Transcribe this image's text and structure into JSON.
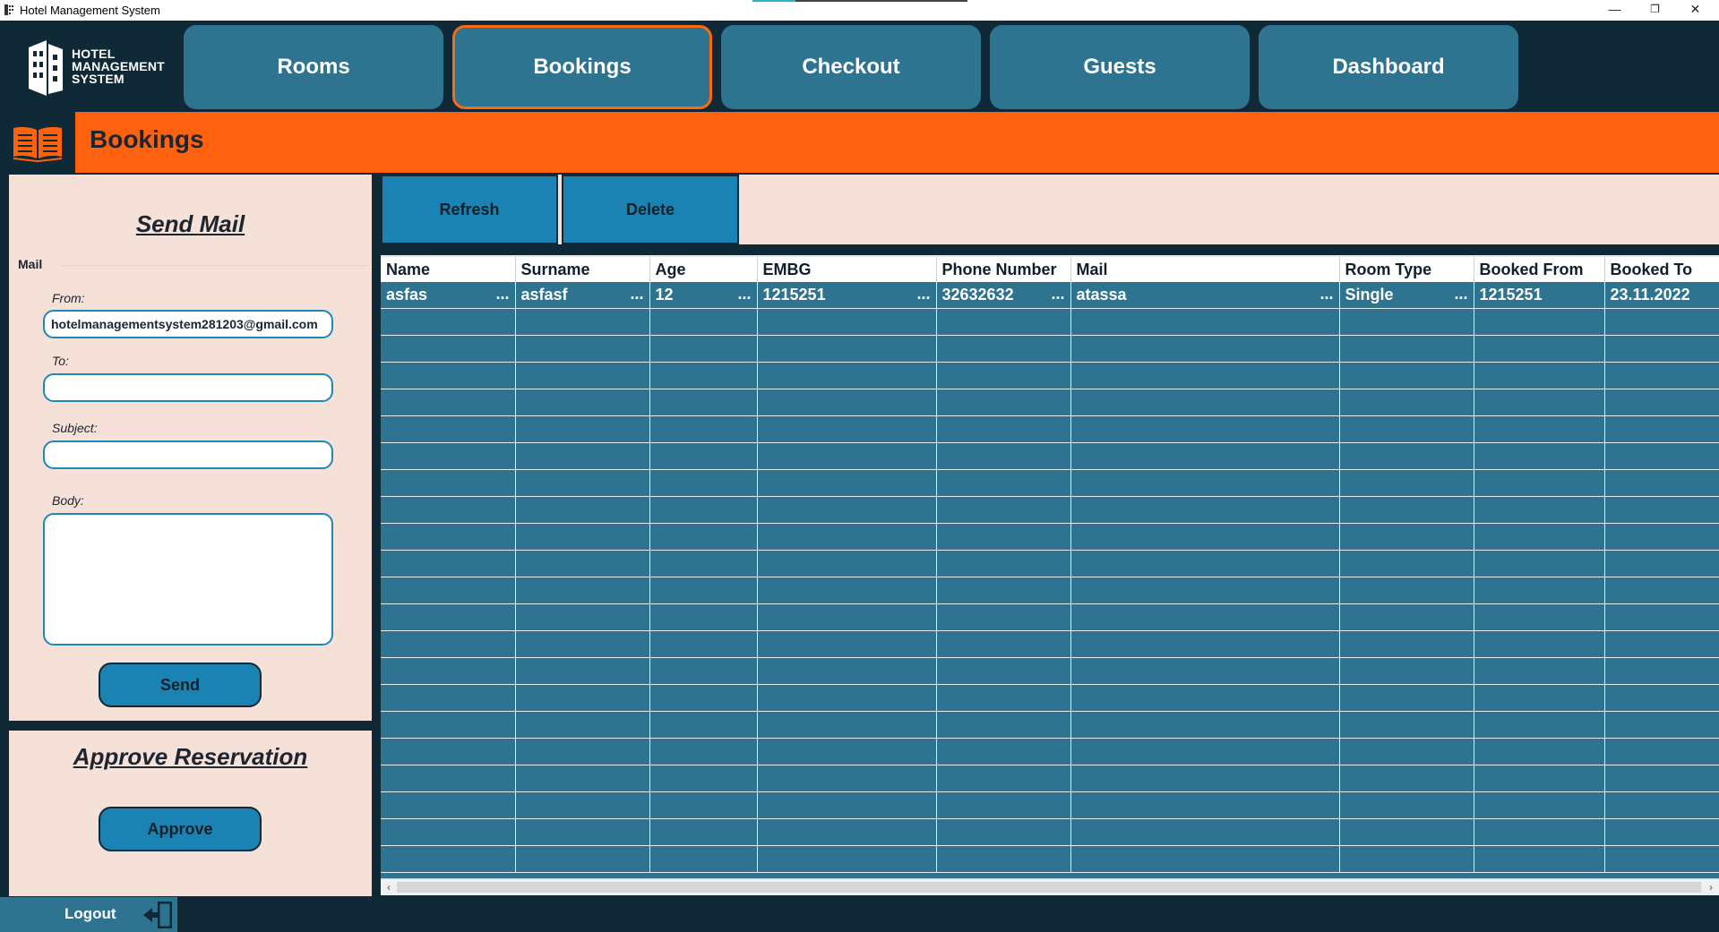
{
  "window": {
    "title": "Hotel Management System",
    "minimize": "—",
    "restore": "❐",
    "close": "✕"
  },
  "logo": {
    "line1": "HOTEL",
    "line2": "MANAGEMENT",
    "line3": "SYSTEM"
  },
  "nav": {
    "rooms": "Rooms",
    "bookings": "Bookings",
    "checkout": "Checkout",
    "guests": "Guests",
    "dashboard": "Dashboard",
    "active": "Bookings"
  },
  "page": {
    "title": "Bookings",
    "icon": "open-book-icon"
  },
  "mail": {
    "heading": "Send Mail",
    "group_label": "Mail",
    "from_label": "From:",
    "from_value": "hotelmanagementsystem281203@gmail.com",
    "to_label": "To:",
    "to_value": "",
    "subject_label": "Subject:",
    "subject_value": "",
    "body_label": "Body:",
    "body_value": "",
    "send_label": "Send"
  },
  "approve": {
    "heading": "Approve Reservation",
    "button_label": "Approve"
  },
  "toolbar": {
    "refresh": "Refresh",
    "delete": "Delete"
  },
  "grid": {
    "columns": [
      "Name",
      "Surname",
      "Age",
      "EMBG",
      "Phone Number",
      "Mail",
      "Room Type",
      "Booked From",
      "Booked To"
    ],
    "rows": [
      [
        "asfas",
        "asfasf",
        "12",
        "1215251",
        "32632632",
        "atassa",
        "Single",
        "1215251",
        "23.11.2022"
      ]
    ],
    "ellipsis": "..."
  },
  "logout": {
    "label": "Logout",
    "icon": "logout-door-icon"
  },
  "colors": {
    "dark": "#0f2a36",
    "teal": "#2e738f",
    "accent_orange": "#ff620f",
    "button_blue": "#1b83b3",
    "panel_bg": "#f5e1d7"
  }
}
